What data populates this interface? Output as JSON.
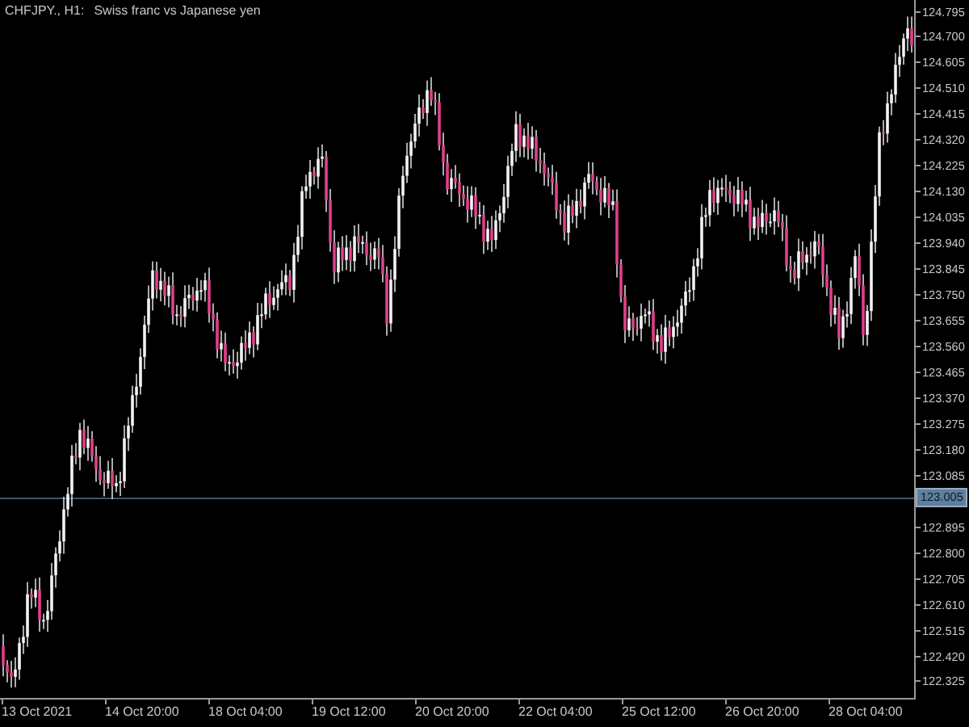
{
  "chart": {
    "symbol_label": "CHFJPY., H1:",
    "description": "Swiss franc vs Japanese yen",
    "price_ticks": [
      "124.795",
      "124.700",
      "124.605",
      "124.510",
      "124.415",
      "124.320",
      "124.225",
      "124.130",
      "124.035",
      "123.940",
      "123.845",
      "123.750",
      "123.655",
      "123.560",
      "123.465",
      "123.370",
      "123.275",
      "123.180",
      "123.085",
      "122.895",
      "122.800",
      "122.705",
      "122.610",
      "122.515",
      "122.420",
      "122.325"
    ],
    "current_price": "123.005",
    "time_labels": [
      "13 Oct 2021",
      "14 Oct 20:00",
      "18 Oct 04:00",
      "19 Oct 12:00",
      "20 Oct 20:00",
      "22 Oct 04:00",
      "25 Oct 12:00",
      "26 Oct 20:00",
      "28 Oct 04:00"
    ]
  }
}
